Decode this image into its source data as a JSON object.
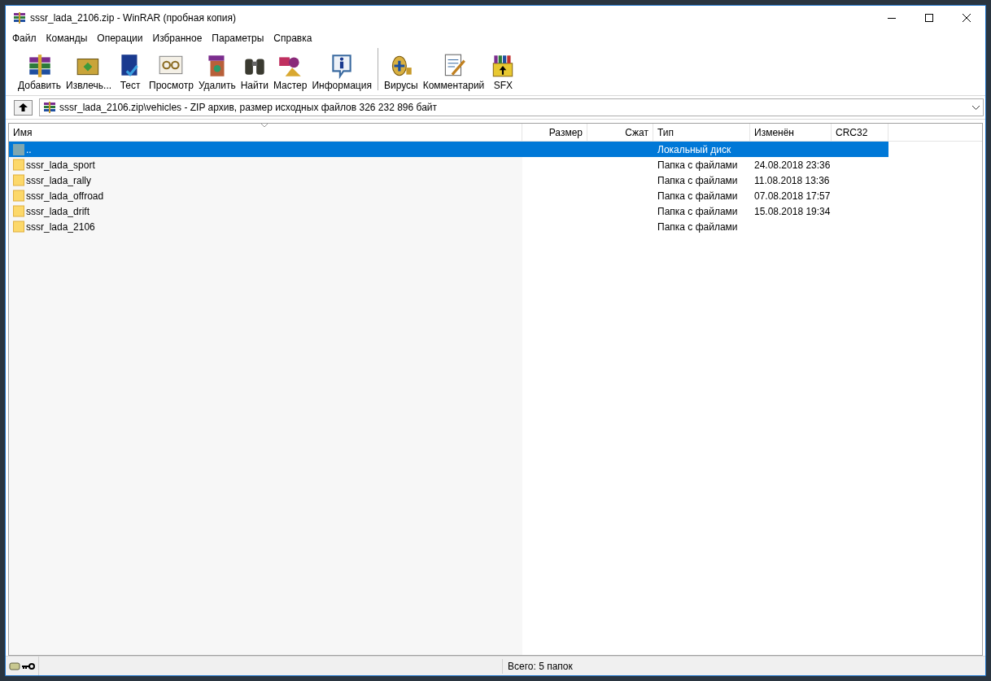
{
  "window": {
    "title": "sssr_lada_2106.zip - WinRAR (пробная копия)"
  },
  "menu": [
    "Файл",
    "Команды",
    "Операции",
    "Избранное",
    "Параметры",
    "Справка"
  ],
  "toolbar": {
    "groups": [
      [
        "Добавить",
        "Извлечь...",
        "Тест",
        "Просмотр",
        "Удалить",
        "Найти",
        "Мастер",
        "Информация"
      ],
      [
        "Вирусы",
        "Комментарий",
        "SFX"
      ]
    ]
  },
  "address": {
    "path": "sssr_lada_2106.zip\\vehicles - ZIP архив, размер исходных файлов 326 232 896 байт"
  },
  "table": {
    "columns": [
      "Имя",
      "Размер",
      "Сжат",
      "Тип",
      "Изменён",
      "CRC32"
    ],
    "rows": [
      {
        "kind": "parent",
        "name": "..",
        "type": "Локальный диск",
        "modified": "",
        "selected": true
      },
      {
        "kind": "folder",
        "name": "sssr_lada_sport",
        "type": "Папка с файлами",
        "modified": "24.08.2018 23:36",
        "selected": false
      },
      {
        "kind": "folder",
        "name": "sssr_lada_rally",
        "type": "Папка с файлами",
        "modified": "11.08.2018 13:36",
        "selected": false
      },
      {
        "kind": "folder",
        "name": "sssr_lada_offroad",
        "type": "Папка с файлами",
        "modified": "07.08.2018 17:57",
        "selected": false
      },
      {
        "kind": "folder",
        "name": "sssr_lada_drift",
        "type": "Папка с файлами",
        "modified": "15.08.2018 19:34",
        "selected": false
      },
      {
        "kind": "folder",
        "name": "sssr_lada_2106",
        "type": "Папка с файлами",
        "modified": "",
        "selected": false
      }
    ]
  },
  "status_bar": {
    "text": "Всего: 5 папок"
  }
}
